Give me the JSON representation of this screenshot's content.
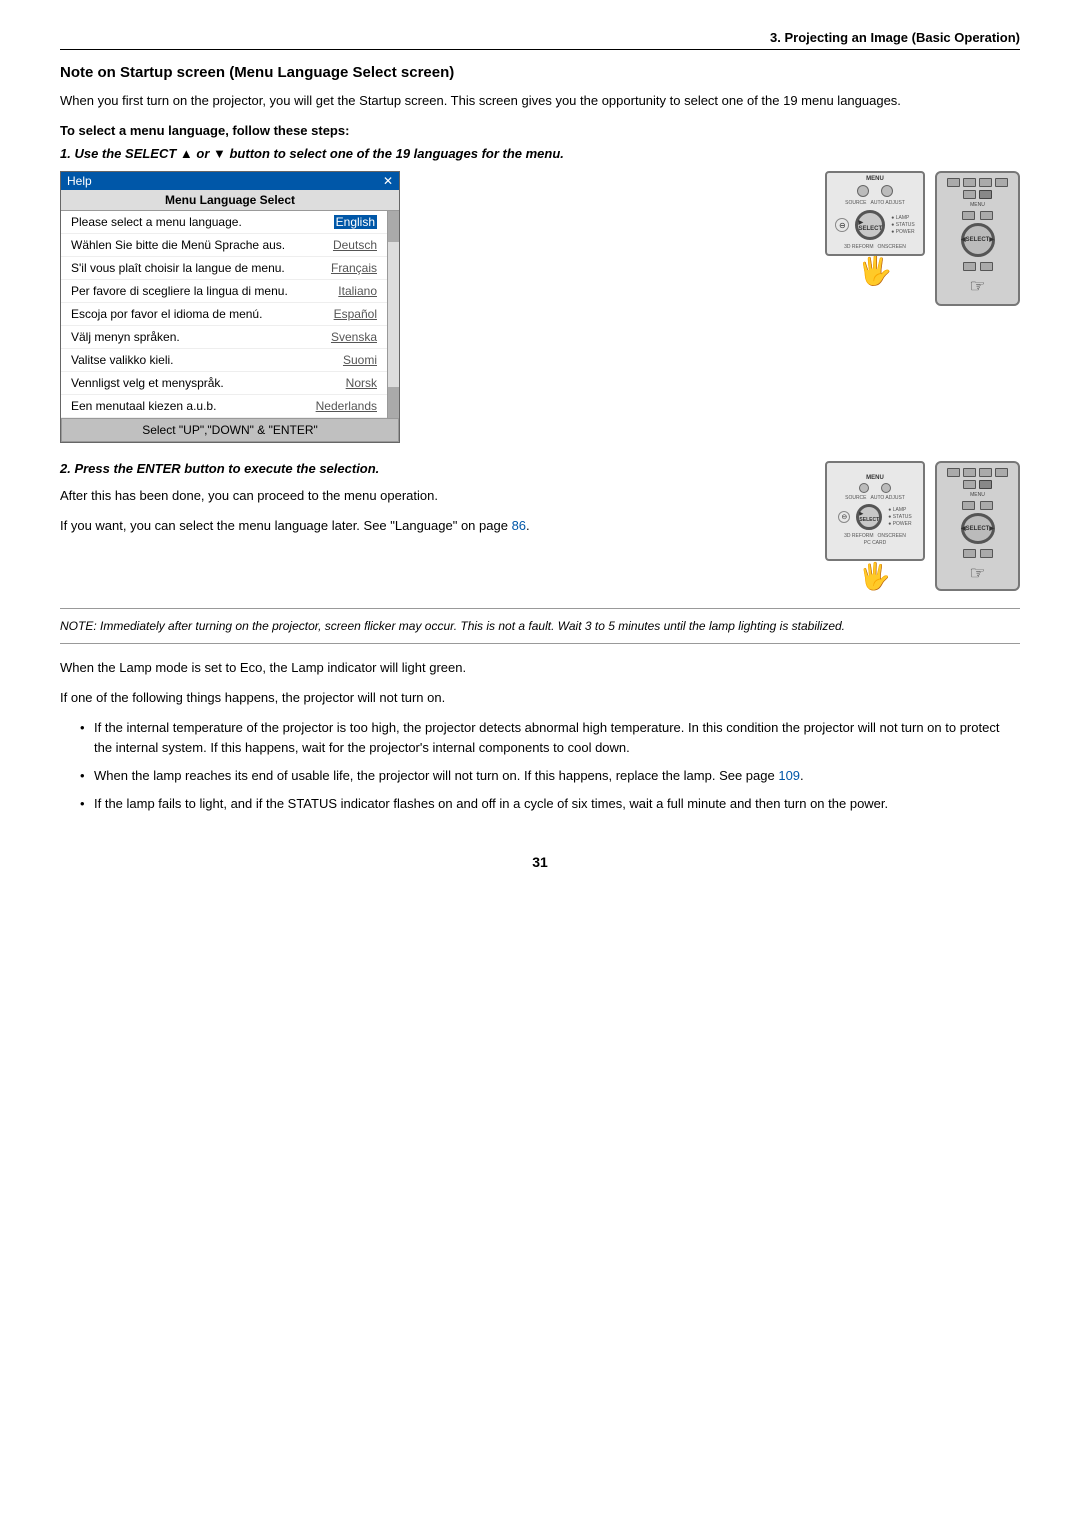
{
  "header": {
    "title": "3. Projecting an Image (Basic Operation)"
  },
  "section": {
    "title": "Note on Startup screen (Menu Language Select screen)",
    "intro": "When you first turn on the projector, you will get the Startup screen. This screen gives you the opportunity to select one of the 19 menu languages.",
    "steps_heading": "To select a menu language, follow these steps:",
    "step1_heading": "1.  Use the SELECT ▲ or ▼ button to select one of the 19 languages for the menu.",
    "step2_heading": "2.  Press the ENTER button to execute the selection.",
    "step2_body1": "After this has been done, you can proceed to the menu operation.",
    "step2_body2": "If you want, you can select the menu language later. See \"Language\" on page ",
    "step2_link": "86",
    "note": "NOTE: Immediately after turning on the projector, screen flicker may occur. This is not a fault. Wait 3 to 5 minutes until the lamp lighting is stabilized.",
    "lamp_mode_text": "When the Lamp mode is set to Eco, the Lamp indicator will light green.",
    "not_turn_on_text": "If one of the following things happens, the projector will not turn on.",
    "bullets": [
      "If the internal temperature of the projector is too high, the projector detects abnormal high temperature. In this condition the projector will not turn on to protect the internal system. If this happens, wait for the projector's internal components to cool down.",
      "When the lamp reaches its end of usable life, the projector will not turn on. If this happens, replace the lamp. See page ",
      "If the lamp fails to light, and if the STATUS indicator flashes on and off in a cycle of six times, wait a full minute and then turn on the power."
    ],
    "bullet2_link": "109",
    "dialog": {
      "header_label": "Help",
      "close_label": "✕",
      "title": "Menu Language Select",
      "rows": [
        {
          "left": "Please select a menu language.",
          "right": "English",
          "selected": true
        },
        {
          "left": "Wählen Sie bitte die Menü Sprache aus.",
          "right": "Deutsch",
          "selected": false
        },
        {
          "left": "S'il vous plaît choisir la langue de menu.",
          "right": "Français",
          "selected": false
        },
        {
          "left": "Per favore di scegliere la lingua di menu.",
          "right": "Italiano",
          "selected": false
        },
        {
          "left": "Escoja por favor el idioma de menú.",
          "right": "Español",
          "selected": false
        },
        {
          "left": "Välj menyn språken.",
          "right": "Svenska",
          "selected": false
        },
        {
          "left": "Valitse valikko kieli.",
          "right": "Suomi",
          "selected": false
        },
        {
          "left": "Vennligst velg et menyspråk.",
          "right": "Norsk",
          "selected": false
        },
        {
          "left": "Een menutaal kiezen a.u.b.",
          "right": "Nederlands",
          "selected": false
        }
      ],
      "footer": "Select  \"UP\",\"DOWN\"  &  \"ENTER\""
    }
  },
  "page_number": "31"
}
